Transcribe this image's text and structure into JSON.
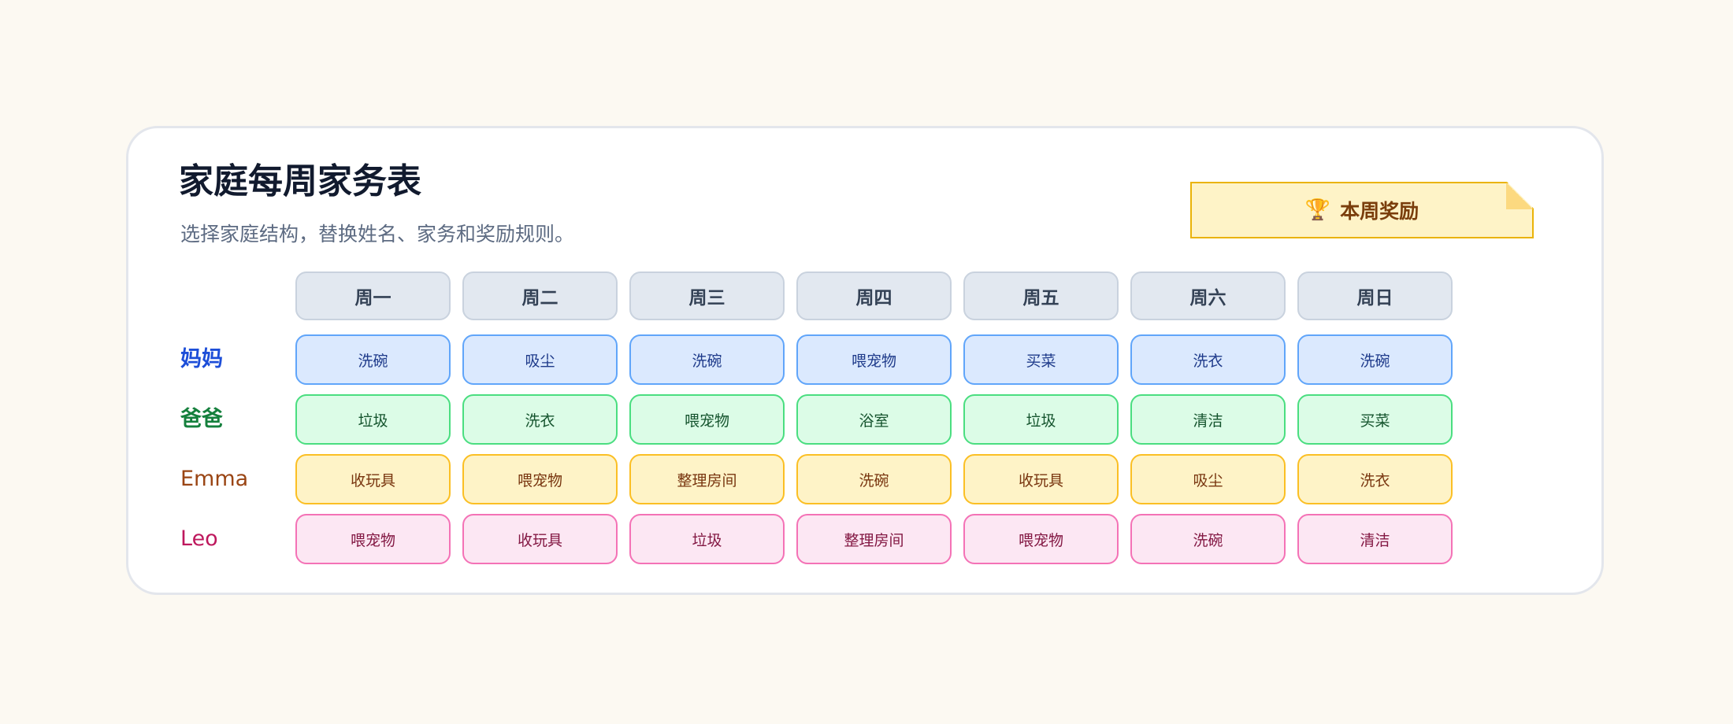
{
  "title": "家庭每周家务表",
  "subtitle": "选择家庭结构，替换姓名、家务和奖励规则。",
  "reward": {
    "icon": "trophy-icon",
    "label": "本周奖励"
  },
  "days": [
    "周一",
    "周二",
    "周三",
    "周四",
    "周五",
    "周六",
    "周日"
  ],
  "members": [
    {
      "name": "妈妈",
      "key": "mom",
      "color": "#1d4ed8",
      "chores": [
        "洗碗",
        "吸尘",
        "洗碗",
        "喂宠物",
        "买菜",
        "洗衣",
        "洗碗"
      ]
    },
    {
      "name": "爸爸",
      "key": "dad",
      "color": "#15803d",
      "chores": [
        "垃圾",
        "洗衣",
        "喂宠物",
        "浴室",
        "垃圾",
        "清洁",
        "买菜"
      ]
    },
    {
      "name": "Emma",
      "key": "emma",
      "color": "#9a4514",
      "chores": [
        "收玩具",
        "喂宠物",
        "整理房间",
        "洗碗",
        "收玩具",
        "吸尘",
        "洗衣"
      ]
    },
    {
      "name": "Leo",
      "key": "leo",
      "color": "#be185d",
      "chores": [
        "喂宠物",
        "收玩具",
        "垃圾",
        "整理房间",
        "喂宠物",
        "洗碗",
        "清洁"
      ]
    }
  ]
}
